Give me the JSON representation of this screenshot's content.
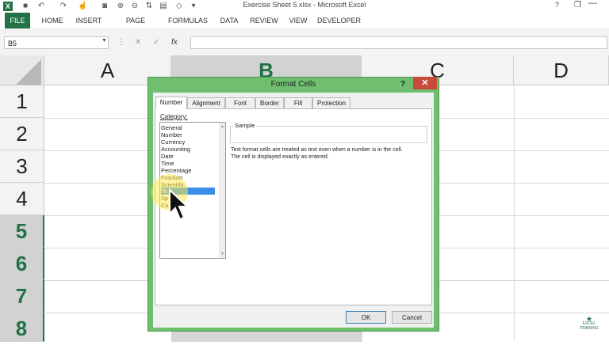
{
  "window": {
    "title": "Exercise Sheet 5.xlsx - Microsoft Excel",
    "help": "?",
    "restore": "❐",
    "minimize": "—"
  },
  "qat": {
    "app_icon_letter": "X",
    "icons": [
      "save-icon",
      "undo-icon",
      "redo-icon",
      "touch-icon",
      "camera-icon",
      "zoom-in-icon",
      "zoom-out-icon",
      "sort-icon",
      "print-preview-icon",
      "more-icon"
    ]
  },
  "ribbon": {
    "tabs": [
      "FILE",
      "HOME",
      "INSERT",
      "PAGE LAYOUT",
      "FORMULAS",
      "DATA",
      "REVIEW",
      "VIEW",
      "DEVELOPER"
    ]
  },
  "formula_bar": {
    "name_box": "B5",
    "cancel_symbol": "✕",
    "enter_symbol": "✓",
    "function_symbol": "fx",
    "formula": ""
  },
  "sheet": {
    "columns": [
      "A",
      "B",
      "C",
      "D"
    ],
    "selected_column": "B",
    "rows": [
      "1",
      "2",
      "3",
      "4",
      "5",
      "6",
      "7",
      "8"
    ],
    "selected_rows": [
      "5",
      "6",
      "7",
      "8"
    ],
    "accent_color": "#217346"
  },
  "dialog": {
    "title": "Format Cells",
    "help": "?",
    "close": "✕",
    "tabs": [
      "Number",
      "Alignment",
      "Font",
      "Border",
      "Fill",
      "Protection"
    ],
    "active_tab": "Number",
    "category_label": "Category:",
    "categories": [
      "General",
      "Number",
      "Currency",
      "Accounting",
      "Date",
      "Time",
      "Percentage",
      "Fraction",
      "Scientific",
      "Text",
      "Special",
      "Custom"
    ],
    "visible_category_text": [
      "General",
      "Number",
      "Currency",
      "Accounting",
      "Date",
      "Time",
      "Percentage",
      "Fraction",
      "Scientific",
      "Te",
      "Sp",
      "Cu"
    ],
    "selected_category": "Text",
    "sample_label": "Sample",
    "description_line1": "Text format cells are treated as text even when a number is in the cell.",
    "description_line2": "The cell is displayed exactly as entered.",
    "ok_label": "OK",
    "cancel_label": "Cancel"
  },
  "watermark": {
    "line1": "EXCEL",
    "line2": "TRAINING"
  }
}
